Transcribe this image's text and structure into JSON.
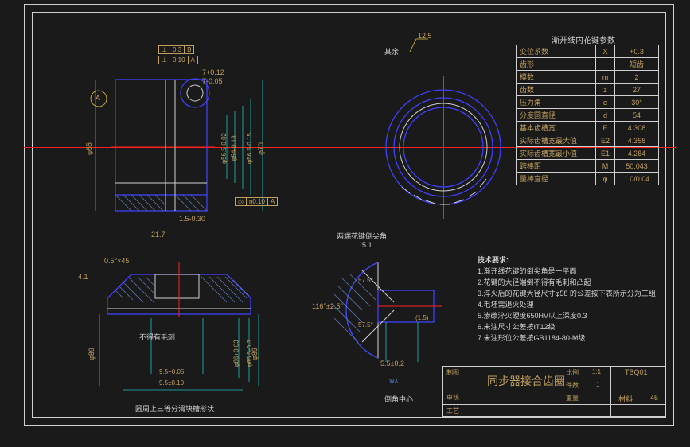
{
  "table_title": "渐开线内花键参数",
  "table": {
    "rows": [
      {
        "p": "变位系数",
        "s": "X",
        "v": "+0.3"
      },
      {
        "p": "齿形",
        "s": "",
        "v": "短齿"
      },
      {
        "p": "模数",
        "s": "m",
        "v": "2"
      },
      {
        "p": "齿数",
        "s": "z",
        "v": "27"
      },
      {
        "p": "压力角",
        "s": "α",
        "v": "30°"
      },
      {
        "p": "分度圆直径",
        "s": "d",
        "v": "54"
      },
      {
        "p": "基本齿槽宽",
        "s": "E",
        "v": "4.308"
      },
      {
        "p": "实际齿槽宽最大值",
        "s": "E2",
        "v": "4.358"
      },
      {
        "p": "实际齿槽宽最小值",
        "s": "E1",
        "v": "4.284"
      },
      {
        "p": "跨棒距",
        "s": "M",
        "v": "50.043"
      },
      {
        "p": "量棒直径",
        "s": "φ",
        "v": "1.0/0.04"
      }
    ]
  },
  "qiyu": "其余",
  "ra_top": "12.5",
  "dims": {
    "d65": "φ65",
    "d70": "φ70",
    "d564": "φ56.5-0.02",
    "d5418": "φ54-0.18",
    "d5618": "φ56.5-0.15",
    "len217": "21.7",
    "len15": "1.5-0.30",
    "tol703": "7+0.12",
    "tol705": "7-0.05",
    "gcf1": "⊥ 0.3 B",
    "gcf2": "⊥ 0.10 A",
    "gcf3": "◎ n0.10 A",
    "datumA": "A",
    "d89": "φ89",
    "d86": "φ86+0.03",
    "d855": "φ85.5-0.3",
    "note_btm1": "不得有毛刺",
    "note_btm2": "圆周上三等分滑块槽形状",
    "cham": "0.5°×45",
    "len41": "4.1",
    "w95a": "9.5±0.10",
    "w95b": "9.5+0.05",
    "mid_title": "两端花键倒尖角",
    "mid51": "5.1",
    "ang116": "116°±2.5°",
    "aux575b": "57.5°",
    "aux575a": "57.5°",
    "dim55": "5.5±0.2",
    "dim15": "(1.5)",
    "mid_note2": "倒角中心",
    "mid_wx": "WX"
  },
  "notes": {
    "title": "技术要求:",
    "n1": "1.渐开线花键的倒尖角是一平面",
    "n2": "2.花键的大径端倒不得有毛刺和凸起",
    "n3": "3.淬火后的花键大径尺寸φ58 的公差按下表所示分为三组",
    "n4": "4.毛坯需退火处理",
    "n5": "5.渗碳淬火硬度650HV以上深度0.3",
    "n6": "6.未注尺寸公差按IT12级",
    "n7": "7.未注形位公差按GB1184-80-M级"
  },
  "titleblock": {
    "main": "同步器接合齿圈",
    "scale_l": "比例",
    "scale_v": "1:1",
    "code": "TBQ01",
    "qty_l": "件数",
    "qty_v": "1",
    "mass_l": "重量",
    "mat_l": "材料",
    "mat_v": "45",
    "col1": "制图",
    "col2": "审核",
    "col3": "工艺"
  }
}
